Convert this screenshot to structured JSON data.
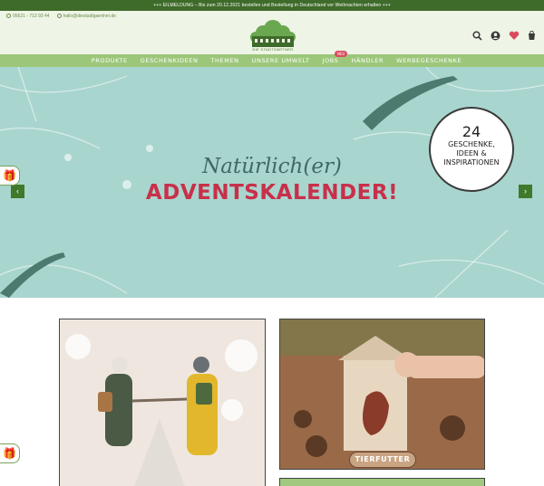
{
  "announcement": "+++ EILMELDUNG – Bis zum 20.12.2021 bestellen und Bestellung in Deutschland vor Weihnachten erhalten +++",
  "contact": {
    "phone": "05621 - 713 93 44",
    "email": "hallo@diestadtgaertner.de"
  },
  "logo": {
    "text": "DIE STADTGÄRTNER"
  },
  "header_icons": [
    "search-icon",
    "user-icon",
    "wishlist-icon",
    "cart-icon"
  ],
  "nav": {
    "items": [
      "PRODUKTE",
      "GESCHENKIDEEN",
      "THEMEN",
      "UNSERE UMWELT",
      "JOBS",
      "HÄNDLER",
      "WERBEGESCHENKE"
    ],
    "jobs_badge": "NEU"
  },
  "hero": {
    "line1": "Natürlich(er)",
    "line2": "ADVENTSKALENDER!",
    "ornament_number": "24",
    "ornament_text": "GESCHENKE, IDEEN & INSPIRATIONEN",
    "prev": "‹",
    "next": "›"
  },
  "tiles": {
    "card2_label": "TIERFUTTER"
  },
  "colors": {
    "green_dark": "#3f6b2a",
    "nav_green": "#9cc77a",
    "hero_bg": "#a9d5cf",
    "red": "#c8304a"
  }
}
